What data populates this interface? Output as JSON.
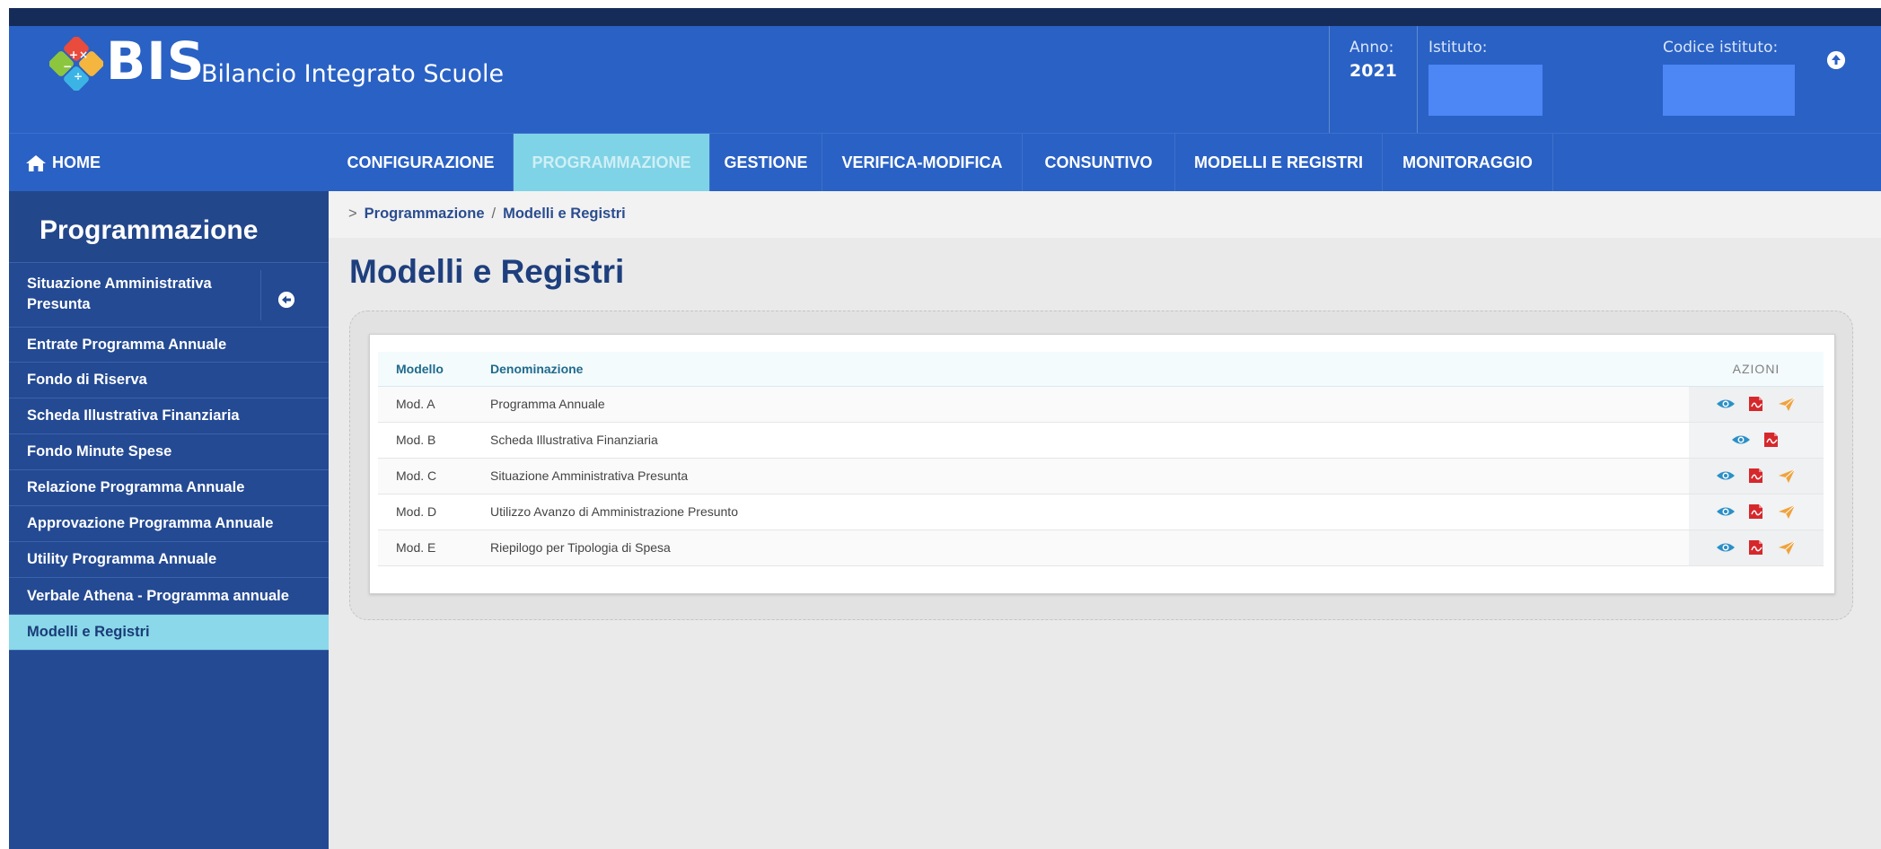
{
  "brand": {
    "name": "BIS",
    "subtitle": "Bilancio Integrato Scuole"
  },
  "header": {
    "anno_label": "Anno:",
    "anno_value": "2021",
    "istituto_label": "Istituto:",
    "codice_label": "Codice istituto:"
  },
  "nav": {
    "home": "HOME",
    "items": [
      {
        "label": "CONFIGURAZIONE"
      },
      {
        "label": "PROGRAMMAZIONE"
      },
      {
        "label": "GESTIONE"
      },
      {
        "label": "VERIFICA-MODIFICA"
      },
      {
        "label": "CONSUNTIVO"
      },
      {
        "label": "MODELLI E REGISTRI"
      },
      {
        "label": "MONITORAGGIO"
      }
    ]
  },
  "sidebar": {
    "title": "Programmazione",
    "items": [
      {
        "label": "Situazione Amministrativa Presunta"
      },
      {
        "label": "Entrate Programma Annuale"
      },
      {
        "label": "Fondo di Riserva"
      },
      {
        "label": "Scheda Illustrativa Finanziaria"
      },
      {
        "label": "Fondo Minute Spese"
      },
      {
        "label": "Relazione Programma Annuale"
      },
      {
        "label": "Approvazione Programma Annuale"
      },
      {
        "label": "Utility Programma Annuale"
      },
      {
        "label": "Verbale Athena - Programma annuale"
      },
      {
        "label": "Modelli e Registri"
      }
    ]
  },
  "breadcrumb": {
    "prefix": ">",
    "parent": "Programmazione",
    "separator": "/",
    "current": "Modelli e Registri"
  },
  "page": {
    "title": "Modelli e Registri"
  },
  "table": {
    "headers": {
      "modello": "Modello",
      "denominazione": "Denominazione",
      "azioni": "AZIONI"
    },
    "rows": [
      {
        "modello": "Mod. A",
        "denominazione": "Programma Annuale"
      },
      {
        "modello": "Mod. B",
        "denominazione": "Scheda Illustrativa Finanziaria"
      },
      {
        "modello": "Mod. C",
        "denominazione": "Situazione Amministrativa Presunta"
      },
      {
        "modello": "Mod. D",
        "denominazione": "Utilizzo Avanzo di Amministrazione Presunto"
      },
      {
        "modello": "Mod. E",
        "denominazione": "Riepilogo per Tipologia di Spesa"
      }
    ]
  },
  "icons": {
    "view": "eye-icon",
    "pdf": "pdf-icon",
    "send": "send-icon",
    "home": "home-icon",
    "collapse": "arrow-circle-left-icon",
    "up": "arrow-circle-up-icon"
  },
  "colors": {
    "header_blue": "#2a61c4",
    "active_tab": "#7fd3e6",
    "sidebar": "#244a93",
    "eye": "#2b8fc7",
    "pdf": "#d6282c",
    "send": "#f0a23c"
  }
}
